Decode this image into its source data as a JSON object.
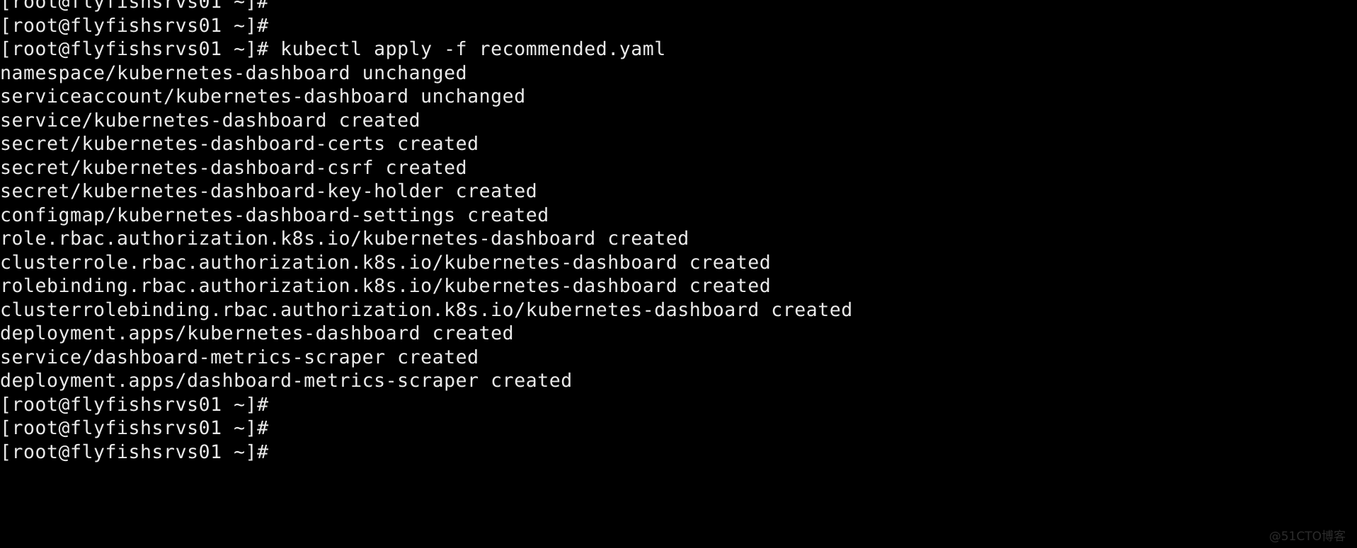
{
  "terminal": {
    "background_color": "#000000",
    "text_color": "#e9e9e9",
    "hostname": "flyfishsrvs01",
    "user": "root",
    "prompt": "[root@flyfishsrvs01 ~]#",
    "command": "kubectl apply -f recommended.yaml",
    "lines": [
      "[root@flyfishsrvs01 ~]#",
      "[root@flyfishsrvs01 ~]#",
      "[root@flyfishsrvs01 ~]# kubectl apply -f recommended.yaml",
      "namespace/kubernetes-dashboard unchanged",
      "serviceaccount/kubernetes-dashboard unchanged",
      "service/kubernetes-dashboard created",
      "secret/kubernetes-dashboard-certs created",
      "secret/kubernetes-dashboard-csrf created",
      "secret/kubernetes-dashboard-key-holder created",
      "configmap/kubernetes-dashboard-settings created",
      "role.rbac.authorization.k8s.io/kubernetes-dashboard created",
      "clusterrole.rbac.authorization.k8s.io/kubernetes-dashboard created",
      "rolebinding.rbac.authorization.k8s.io/kubernetes-dashboard created",
      "clusterrolebinding.rbac.authorization.k8s.io/kubernetes-dashboard created",
      "deployment.apps/kubernetes-dashboard created",
      "service/dashboard-metrics-scraper created",
      "deployment.apps/dashboard-metrics-scraper created",
      "[root@flyfishsrvs01 ~]#",
      "[root@flyfishsrvs01 ~]#",
      "[root@flyfishsrvs01 ~]#"
    ]
  },
  "watermark": {
    "text": "@51CTO博客",
    "color": "#2c2c2c"
  }
}
